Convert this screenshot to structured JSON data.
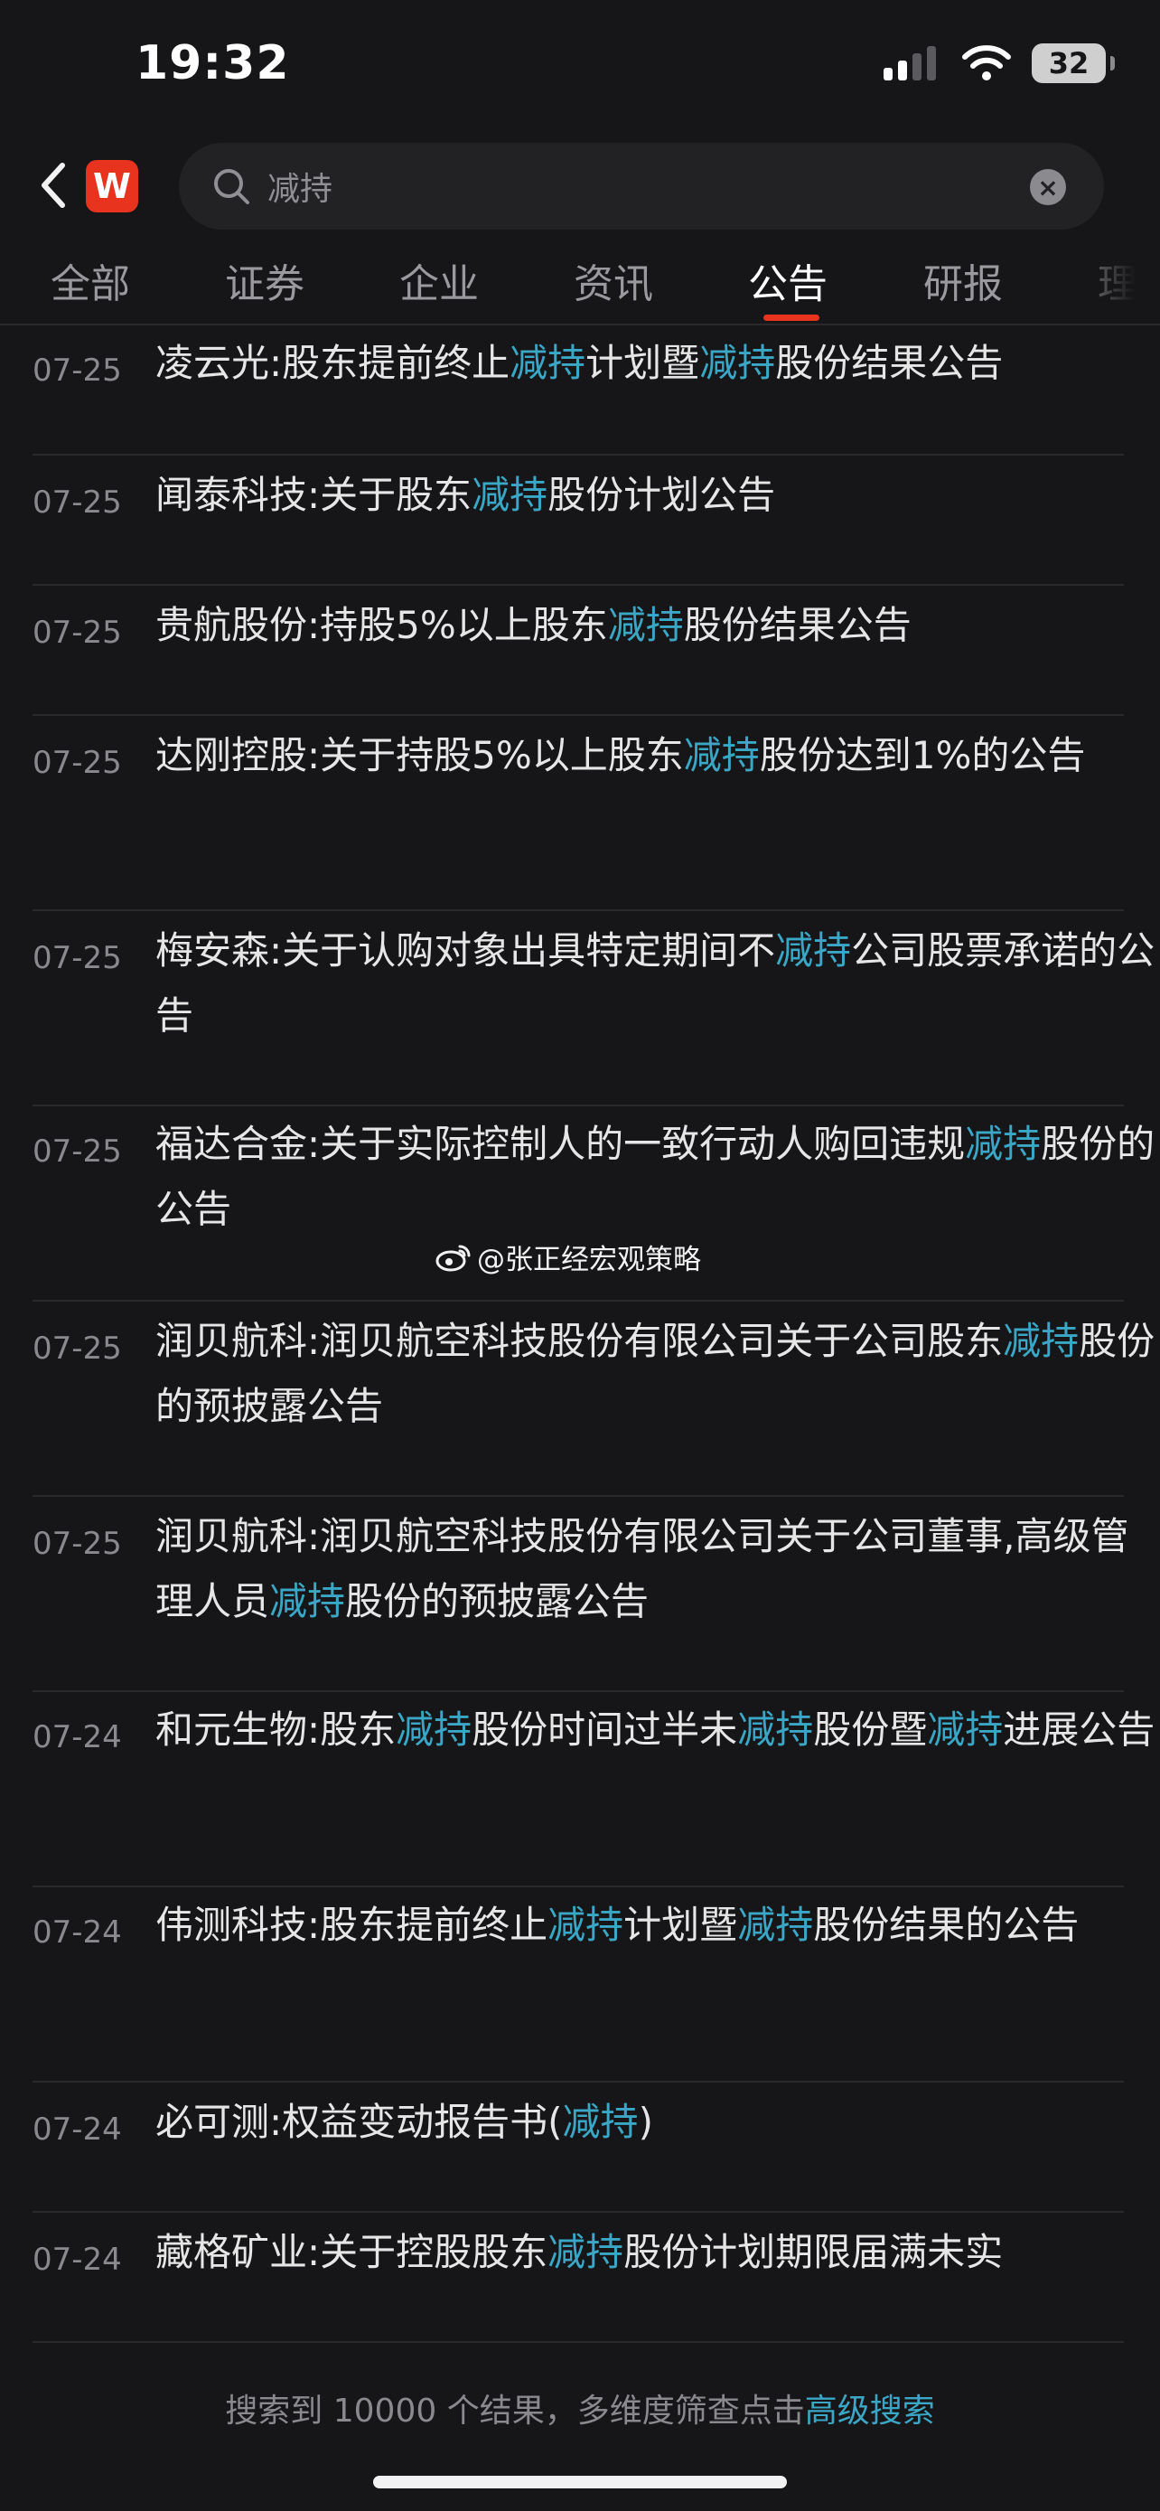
{
  "status_bar": {
    "time": "19:32",
    "battery": "32"
  },
  "search": {
    "logo": "W",
    "query": "减持"
  },
  "tabs": [
    {
      "label": "全部"
    },
    {
      "label": "证券"
    },
    {
      "label": "企业"
    },
    {
      "label": "资讯"
    },
    {
      "label": "公告",
      "active": true
    },
    {
      "label": "研报"
    },
    {
      "label": "理财"
    }
  ],
  "results": [
    {
      "date": "07-25",
      "parts": [
        {
          "t": "凌云光:股东提前终止"
        },
        {
          "t": "减持",
          "hl": true
        },
        {
          "t": "计划暨"
        },
        {
          "t": "减持",
          "hl": true
        },
        {
          "t": "股份结果公告"
        }
      ]
    },
    {
      "date": "07-25",
      "parts": [
        {
          "t": "闻泰科技:关于股东"
        },
        {
          "t": "减持",
          "hl": true
        },
        {
          "t": "股份计划公告"
        }
      ]
    },
    {
      "date": "07-25",
      "parts": [
        {
          "t": "贵航股份:持股5%以上股东"
        },
        {
          "t": "减持",
          "hl": true
        },
        {
          "t": "股份结果公告"
        }
      ]
    },
    {
      "date": "07-25",
      "parts": [
        {
          "t": "达刚控股:关于持股5%以上股东"
        },
        {
          "t": "减持",
          "hl": true
        },
        {
          "t": "股份达到1%的公告"
        }
      ]
    },
    {
      "date": "07-25",
      "parts": [
        {
          "t": "梅安森:关于认购对象出具特定期间不"
        },
        {
          "t": "减持",
          "hl": true
        },
        {
          "t": "公司股票承诺的公告"
        }
      ]
    },
    {
      "date": "07-25",
      "parts": [
        {
          "t": "福达合金:关于实际控制人的一致行动人购回违规"
        },
        {
          "t": "减持",
          "hl": true
        },
        {
          "t": "股份的公告"
        }
      ]
    },
    {
      "date": "07-25",
      "parts": [
        {
          "t": "润贝航科:润贝航空科技股份有限公司关于公司股东"
        },
        {
          "t": "减持",
          "hl": true
        },
        {
          "t": "股份的预披露公告"
        }
      ]
    },
    {
      "date": "07-25",
      "parts": [
        {
          "t": "润贝航科:润贝航空科技股份有限公司关于公司董事,高级管理人员"
        },
        {
          "t": "减持",
          "hl": true
        },
        {
          "t": "股份的预披露公告"
        }
      ]
    },
    {
      "date": "07-24",
      "parts": [
        {
          "t": "和元生物:股东"
        },
        {
          "t": "减持",
          "hl": true
        },
        {
          "t": "股份时间过半未"
        },
        {
          "t": "减持",
          "hl": true
        },
        {
          "t": "股份暨"
        },
        {
          "t": "减持",
          "hl": true
        },
        {
          "t": "进展公告"
        }
      ]
    },
    {
      "date": "07-24",
      "parts": [
        {
          "t": "伟测科技:股东提前终止"
        },
        {
          "t": "减持",
          "hl": true
        },
        {
          "t": "计划暨"
        },
        {
          "t": "减持",
          "hl": true
        },
        {
          "t": "股份结果的公告"
        }
      ]
    },
    {
      "date": "07-24",
      "parts": [
        {
          "t": "必可测:权益变动报告书("
        },
        {
          "t": "减持",
          "hl": true
        },
        {
          "t": ")"
        }
      ]
    },
    {
      "date": "07-24",
      "parts": [
        {
          "t": "藏格矿业:关于控股股东"
        },
        {
          "t": "减持",
          "hl": true
        },
        {
          "t": "股份计划期限届满未实"
        }
      ]
    }
  ],
  "watermark": "@张正经宏观策略",
  "footer": {
    "prefix": "搜索到 10000 个结果，多维度筛查点击",
    "link": "高级搜索"
  },
  "colors": {
    "highlight": "#3aa7c6",
    "accent": "#e8331f",
    "background": "#161618"
  }
}
